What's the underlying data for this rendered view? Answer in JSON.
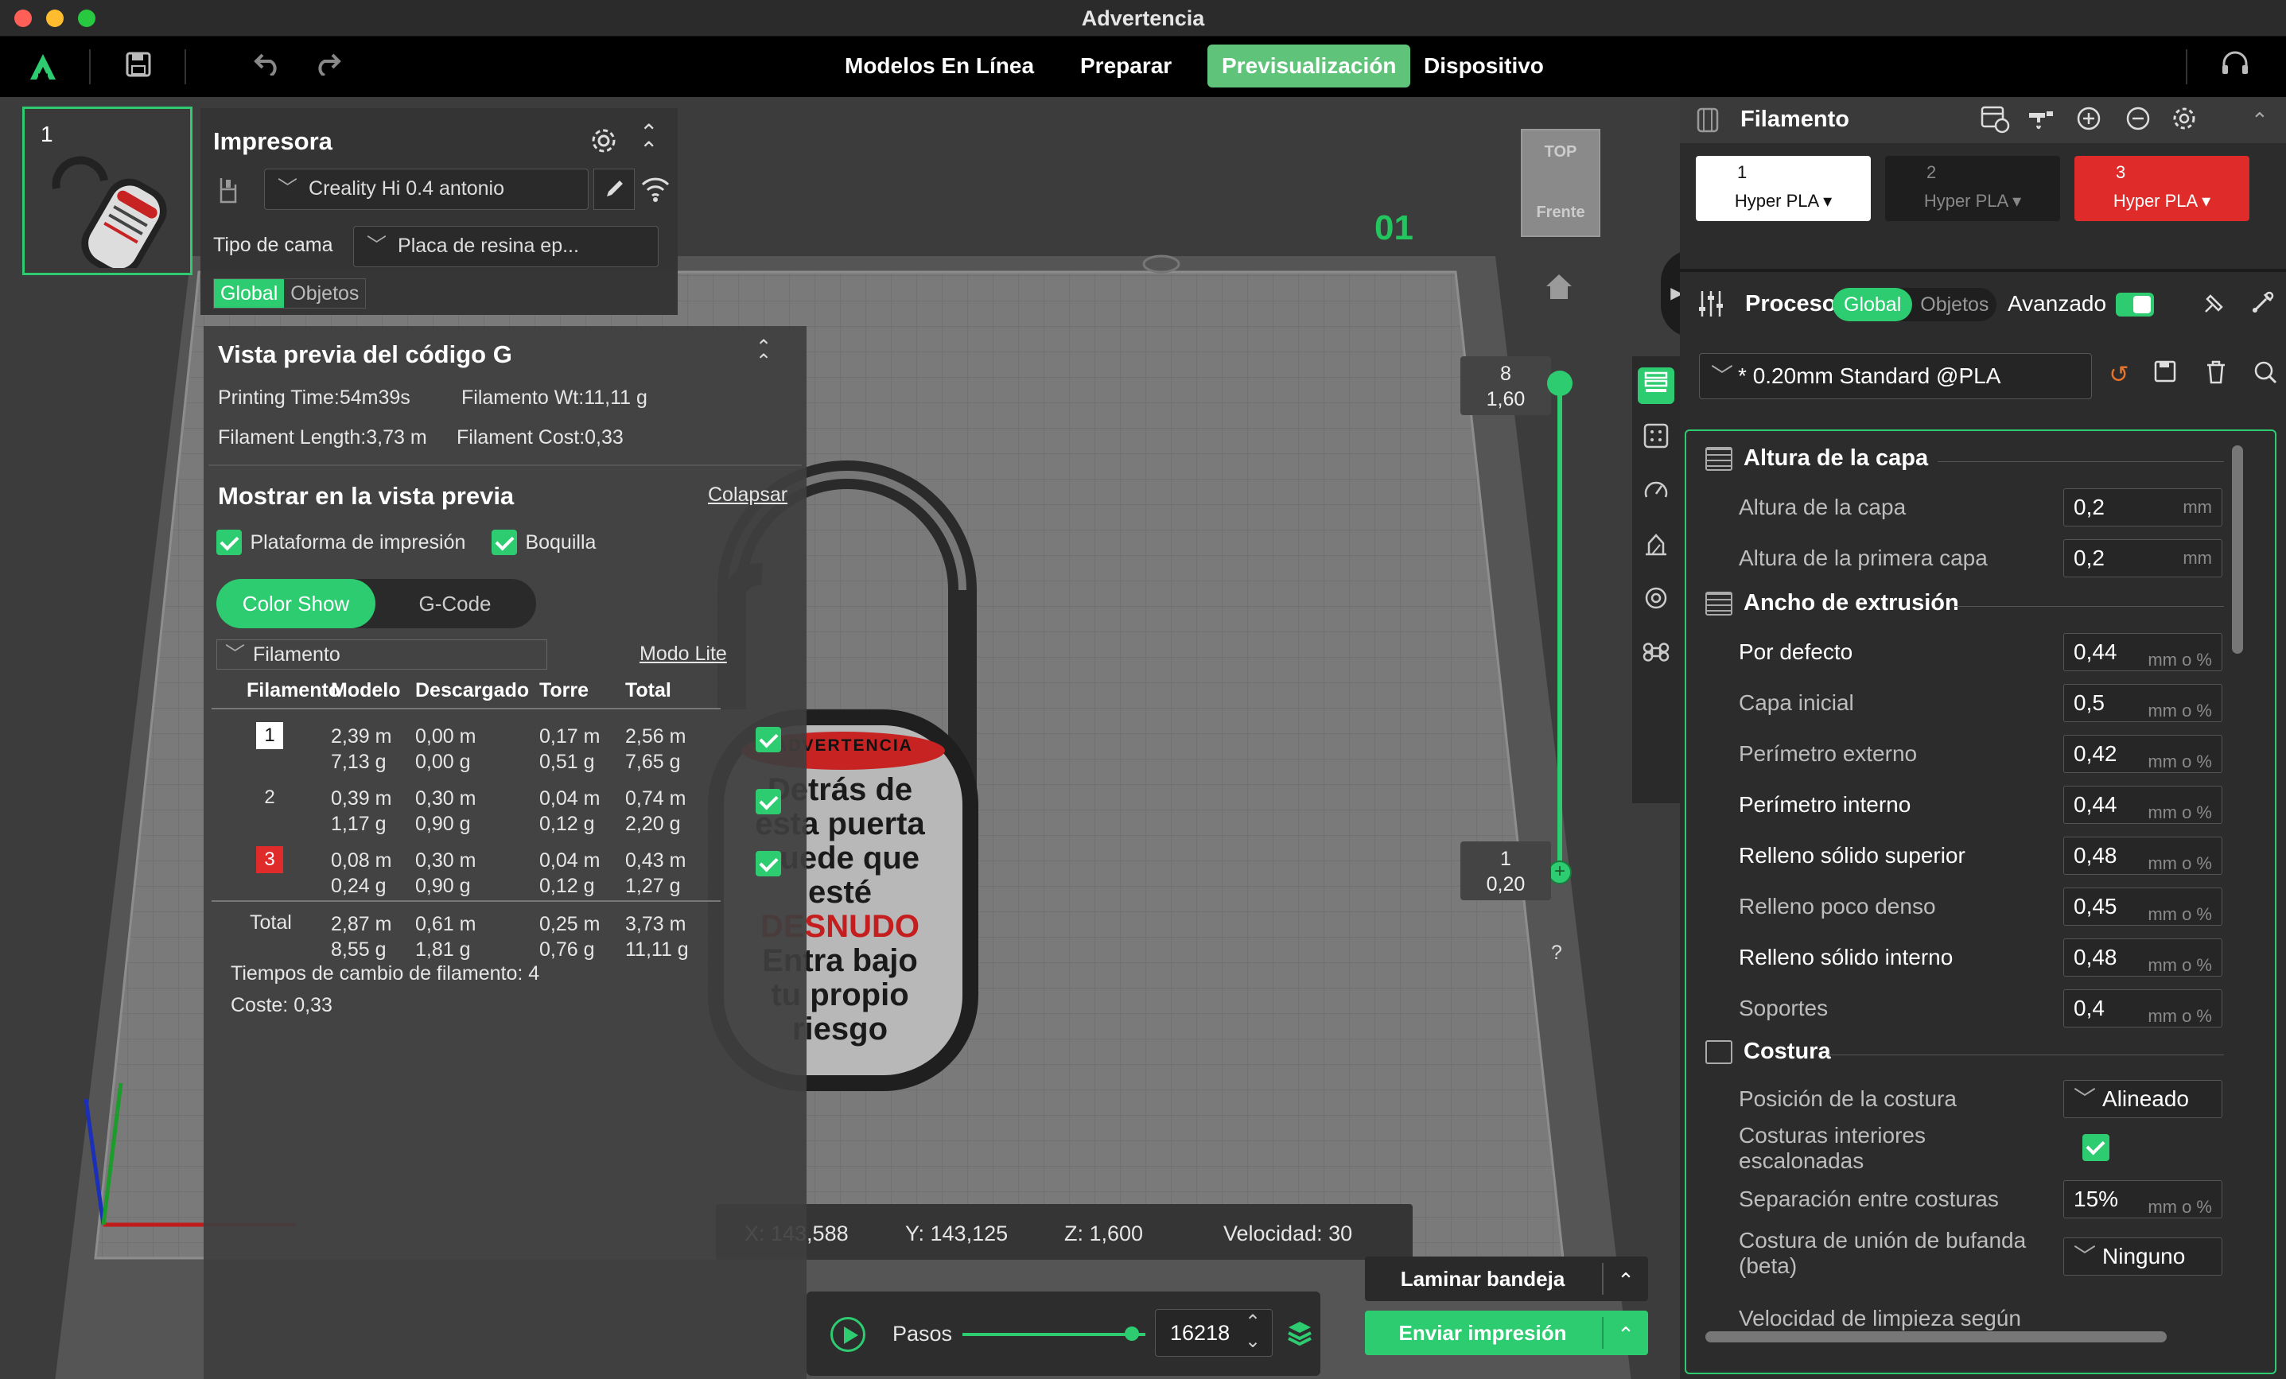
{
  "window": {
    "title": "Advertencia"
  },
  "tabs": [
    "Modelos En Línea",
    "Preparar",
    "Previsualización",
    "Dispositivo"
  ],
  "active_tab": "Previsualización",
  "view": {
    "plate_number": "1",
    "plate_label": "01",
    "cube_top": "TOP",
    "cube_front": "Frente",
    "layer_top_num": "8",
    "layer_top_height": "1,60",
    "layer_bottom_num": "1",
    "layer_bottom_height": "0,20",
    "help": "?",
    "coords": {
      "x": "X: 143,588",
      "y": "Y: 143,125",
      "z": "Z: 1,600",
      "speed": "Velocidad: 30"
    },
    "model_text": {
      "banner": "ADVERTENCIA",
      "lines": [
        "Detrás de",
        "esta puerta",
        "puede que",
        "esté",
        "DESNUDO",
        "Entra bajo",
        "tu propio",
        "riesgo"
      ]
    }
  },
  "printer": {
    "title": "Impresora",
    "name": "Creality Hi 0.4 antonio",
    "bed_label": "Tipo de cama",
    "bed_value": "Placa de resina ep...",
    "tab_global": "Global",
    "tab_objects": "Objetos"
  },
  "gcode": {
    "title": "Vista previa del código G",
    "printing_time": "Printing Time:54m39s",
    "filament_wt": "Filamento Wt:11,11 g",
    "filament_length": "Filament Length:3,73 m",
    "filament_cost": "Filament Cost:0,33",
    "show_title": "Mostrar en la vista previa",
    "collapse": "Colapsar",
    "cb_plate": "Plataforma de impresión",
    "cb_nozzle": "Boquilla",
    "btn_color": "Color Show",
    "btn_gcode": "G-Code",
    "view_select": "Filamento",
    "lite": "Modo Lite",
    "headers": [
      "Filamento",
      "Modelo",
      "Descargado",
      "Torre",
      "Total"
    ],
    "rows": [
      {
        "id": "1",
        "color": "#ffffff",
        "model": [
          "2,39 m",
          "7,13 g"
        ],
        "flushed": [
          "0,00 m",
          "0,00 g"
        ],
        "tower": [
          "0,17 m",
          "0,51 g"
        ],
        "total": [
          "2,56 m",
          "7,65 g"
        ]
      },
      {
        "id": "2",
        "color": "",
        "model": [
          "0,39 m",
          "1,17 g"
        ],
        "flushed": [
          "0,30 m",
          "0,90 g"
        ],
        "tower": [
          "0,04 m",
          "0,12 g"
        ],
        "total": [
          "0,74 m",
          "2,20 g"
        ]
      },
      {
        "id": "3",
        "color": "#e02b2b",
        "model": [
          "0,08 m",
          "0,24 g"
        ],
        "flushed": [
          "0,30 m",
          "0,90 g"
        ],
        "tower": [
          "0,04 m",
          "0,12 g"
        ],
        "total": [
          "0,43 m",
          "1,27 g"
        ]
      }
    ],
    "total_row": {
      "label": "Total",
      "model": [
        "2,87 m",
        "8,55 g"
      ],
      "flushed": [
        "0,61 m",
        "1,81 g"
      ],
      "tower": [
        "0,25 m",
        "0,76 g"
      ],
      "total": [
        "3,73 m",
        "11,11 g"
      ]
    },
    "change_times": "Tiempos de cambio de filamento:  4",
    "cost": "Coste:  0,33"
  },
  "playback": {
    "label": "Pasos",
    "value": "16218"
  },
  "actions": {
    "slice": "Laminar bandeja",
    "send": "Enviar impresión"
  },
  "filament_panel": {
    "title": "Filamento",
    "slots": [
      {
        "n": "1",
        "name": "Hyper PLA",
        "color": "#ffffff"
      },
      {
        "n": "2",
        "name": "Hyper PLA",
        "color": "#1e1e1e"
      },
      {
        "n": "3",
        "name": "Hyper PLA",
        "color": "#e02b2b"
      }
    ]
  },
  "process": {
    "title": "Proceso",
    "tab_global": "Global",
    "tab_objects": "Objetos",
    "advanced": "Avanzado",
    "profile": "* 0.20mm Standard @PLA",
    "sections": {
      "layer": "Altura de la capa",
      "width": "Ancho de extrusión",
      "seam": "Costura"
    },
    "params": {
      "layer_height": {
        "label": "Altura de la capa",
        "value": "0,2",
        "unit": "mm"
      },
      "first_layer": {
        "label": "Altura de la primera capa",
        "value": "0,2",
        "unit": "mm"
      },
      "default": {
        "label": "Por defecto",
        "value": "0,44",
        "unit": "mm o %"
      },
      "initial": {
        "label": "Capa inicial",
        "value": "0,5",
        "unit": "mm o %"
      },
      "outer": {
        "label": "Perímetro externo",
        "value": "0,42",
        "unit": "mm o %"
      },
      "inner": {
        "label": "Perímetro interno",
        "value": "0,44",
        "unit": "mm o %"
      },
      "top_solid": {
        "label": "Relleno sólido superior",
        "value": "0,48",
        "unit": "mm o %"
      },
      "sparse": {
        "label": "Relleno poco denso",
        "value": "0,45",
        "unit": "mm o %"
      },
      "internal_solid": {
        "label": "Relleno sólido interno",
        "value": "0,48",
        "unit": "mm o %"
      },
      "support": {
        "label": "Soportes",
        "value": "0,4",
        "unit": "mm o %"
      },
      "seam_pos": {
        "label": "Posición de la costura",
        "value": "Alineado"
      },
      "staggered": {
        "label": "Costuras interiores escalonadas"
      },
      "seam_gap": {
        "label": "Separación entre costuras",
        "value": "15%",
        "unit": "mm o %"
      },
      "scarf": {
        "label": "Costura de unión de bufanda (beta)",
        "value": "Ninguno"
      },
      "wipe_speed": {
        "label": "Velocidad de limpieza según"
      }
    }
  }
}
